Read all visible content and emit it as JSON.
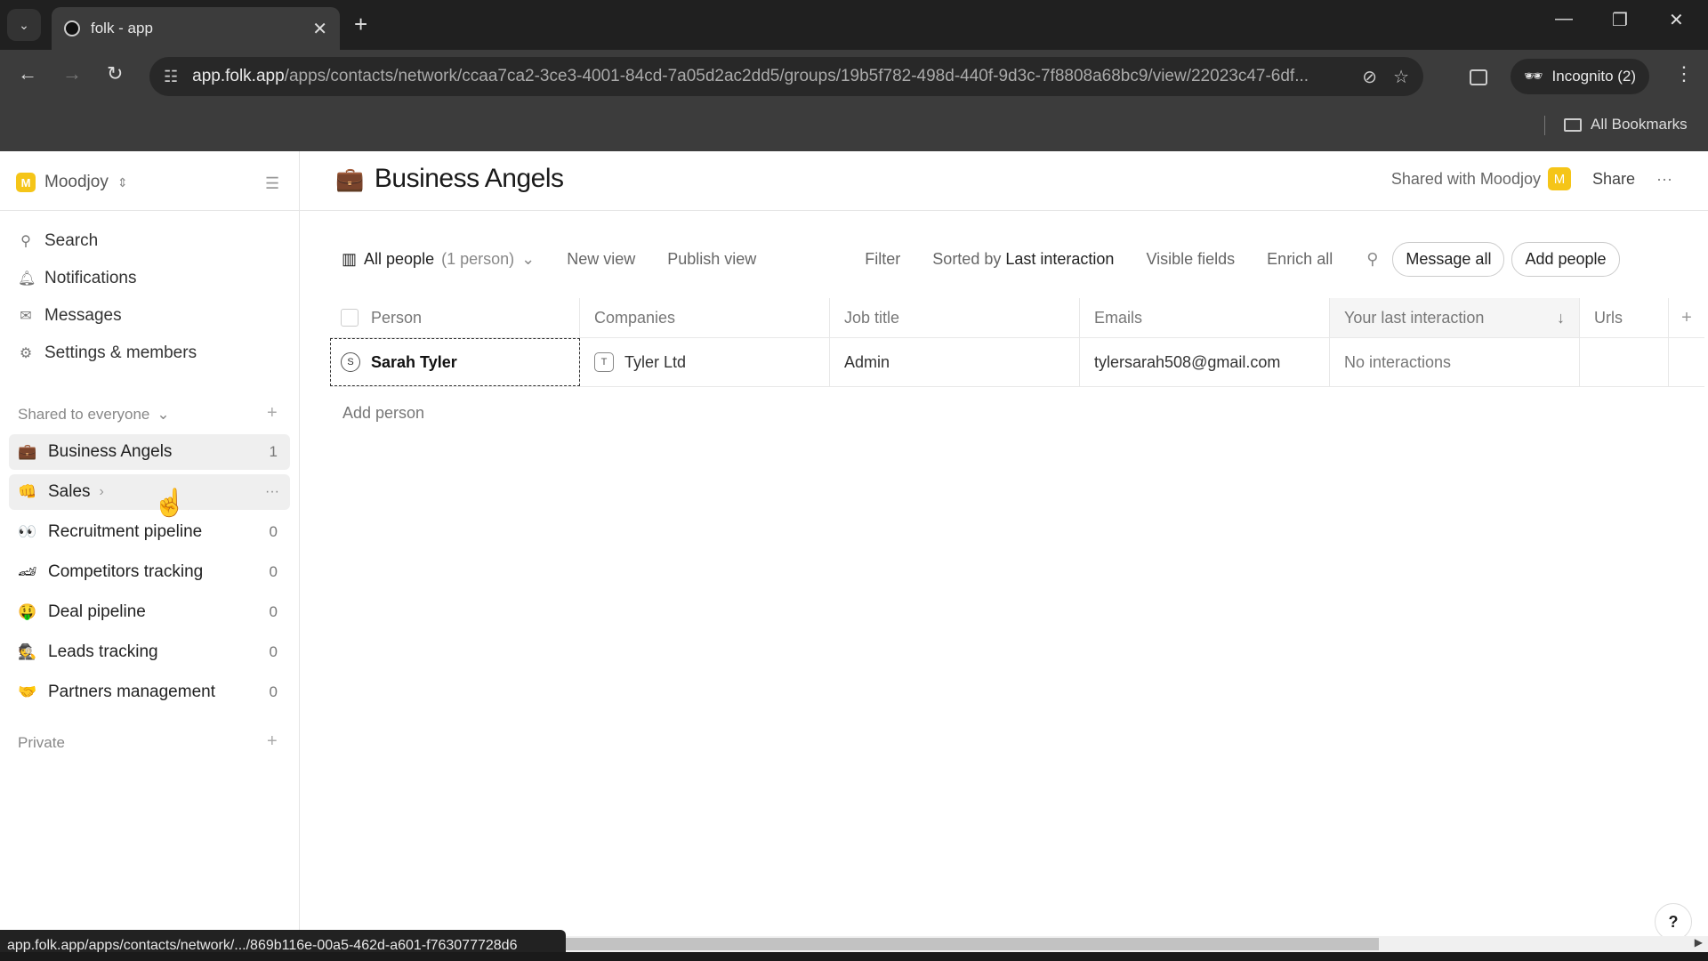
{
  "browser": {
    "tab_title": "folk - app",
    "url_host": "app.folk.app",
    "url_path": "/apps/contacts/network/ccaa7ca2-3ce3-4001-84cd-7a05d2ac2dd5/groups/19b5f782-498d-440f-9d3c-7f8808a68bc9/view/22023c47-6df...",
    "incognito_label": "Incognito (2)",
    "bookmarks_label": "All Bookmarks",
    "status_url": "app.folk.app/apps/contacts/network/.../869b116e-00a5-462d-a601-f763077728d6"
  },
  "sidebar": {
    "workspace_initial": "M",
    "workspace_name": "Moodjoy",
    "nav": [
      {
        "label": "Search",
        "icon": "search-icon"
      },
      {
        "label": "Notifications",
        "icon": "bell-icon"
      },
      {
        "label": "Messages",
        "icon": "mail-icon"
      },
      {
        "label": "Settings & members",
        "icon": "gear-icon"
      }
    ],
    "shared_section": "Shared to everyone",
    "groups": [
      {
        "emoji": "💼",
        "label": "Business Angels",
        "count": "1"
      },
      {
        "emoji": "👊",
        "label": "Sales",
        "count": ""
      },
      {
        "emoji": "👀",
        "label": "Recruitment pipeline",
        "count": "0"
      },
      {
        "emoji": "🏎",
        "label": "Competitors tracking",
        "count": "0"
      },
      {
        "emoji": "🤑",
        "label": "Deal pipeline",
        "count": "0"
      },
      {
        "emoji": "🕵",
        "label": "Leads tracking",
        "count": "0"
      },
      {
        "emoji": "🤝",
        "label": "Partners management",
        "count": "0"
      }
    ],
    "private_section": "Private"
  },
  "header": {
    "emoji": "💼",
    "title": "Business Angels",
    "shared_with": "Shared with Moodjoy",
    "avatar_initial": "M",
    "share_label": "Share"
  },
  "viewbar": {
    "view_name": "All people",
    "view_count": "(1 person)",
    "new_view": "New view",
    "publish_view": "Publish view",
    "filter": "Filter",
    "sorted_prefix": "Sorted by",
    "sorted_field": "Last interaction",
    "visible_fields": "Visible fields",
    "enrich_all": "Enrich all",
    "message_all": "Message all",
    "add_people": "Add people"
  },
  "table": {
    "columns": [
      "Person",
      "Companies",
      "Job title",
      "Emails",
      "Your last interaction",
      "Urls"
    ],
    "rows": [
      {
        "person_initial": "S",
        "person": "Sarah Tyler",
        "company_initial": "T",
        "company": "Tyler Ltd",
        "job_title": "Admin",
        "email": "tylersarah508@gmail.com",
        "last_interaction": "No interactions",
        "urls": ""
      }
    ],
    "add_person": "Add person"
  },
  "colors": {
    "brand_yellow": "#f5c518"
  }
}
